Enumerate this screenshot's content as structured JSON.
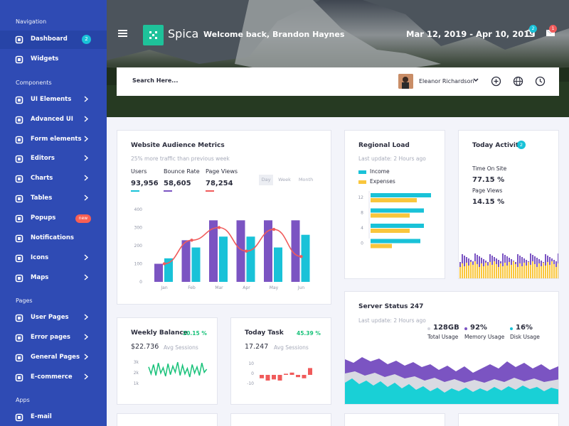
{
  "sidebar": {
    "sections": [
      "Navigation",
      "Components",
      "Pages",
      "Apps"
    ],
    "items": [
      {
        "label": "Dashboard",
        "icon": "dashboard-icon",
        "badge": "2"
      },
      {
        "label": "Widgets",
        "icon": "monitor-icon"
      },
      {
        "label": "UI Elements",
        "icon": "palette-icon"
      },
      {
        "label": "Advanced UI",
        "icon": "layers-icon"
      },
      {
        "label": "Form elements",
        "icon": "form-icon"
      },
      {
        "label": "Editors",
        "icon": "edit-icon"
      },
      {
        "label": "Charts",
        "icon": "pie-chart-icon"
      },
      {
        "label": "Tables",
        "icon": "table-icon"
      },
      {
        "label": "Popups",
        "icon": "chat-icon",
        "badge": "new"
      },
      {
        "label": "Notifications",
        "icon": "bell-icon"
      },
      {
        "label": "Icons",
        "icon": "smile-icon"
      },
      {
        "label": "Maps",
        "icon": "map-icon"
      },
      {
        "label": "User Pages",
        "icon": "user-icon"
      },
      {
        "label": "Error pages",
        "icon": "warning-icon"
      },
      {
        "label": "General Pages",
        "icon": "file-icon"
      },
      {
        "label": "E-commerce",
        "icon": "cart-icon"
      },
      {
        "label": "E-mail",
        "icon": "mail-icon"
      }
    ]
  },
  "header": {
    "logo": "Spica",
    "welcome": "Welcome back, Brandon Haynes",
    "date_range": "Mar 12, 2019 - Apr 10, 2019",
    "notif_badge": "2",
    "mail_badge": "1",
    "search_placeholder": "Search Here...",
    "user_name": "Eleanor Richardson"
  },
  "audience": {
    "title": "Website Audience Metrics",
    "subtitle": "25% more traffic than previous week",
    "stats": [
      {
        "label": "Users",
        "value": "93,956"
      },
      {
        "label": "Bounce Rate",
        "value": "58,605"
      },
      {
        "label": "Page Views",
        "value": "78,254"
      }
    ],
    "tabs": [
      "Day",
      "Week",
      "Month"
    ]
  },
  "regional": {
    "title": "Regional Load",
    "update": "Last update: 2 Hours ago",
    "legend": [
      "Income",
      "Expenses"
    ]
  },
  "activity": {
    "title": "Today Activity",
    "badge": "2",
    "label1": "Time On Site",
    "value1": "77.15 %",
    "label2": "Page Views",
    "value2": "14.15 %"
  },
  "server": {
    "title": "Server Status 247",
    "update": "Last update: 2 Hours ago",
    "stats": [
      {
        "value": "128GB",
        "label": "Total Usage"
      },
      {
        "value": "92%",
        "label": "Memory Usage"
      },
      {
        "value": "16%",
        "label": "Disk Usage"
      }
    ]
  },
  "weekly": {
    "title": "Weekly Balance",
    "percent": "20.15 %",
    "value": "$22.736",
    "caption": "Avg Sessions"
  },
  "task": {
    "title": "Today Task",
    "percent": "45.39 %",
    "value": "17.247",
    "caption": "Avg Sessions"
  },
  "colors": {
    "sidebar": "#2f4bb4",
    "teal": "#19c2d8",
    "purple": "#7b54c2",
    "red": "#f05b5b",
    "yellow": "#f9c63c",
    "green": "#19c27a"
  },
  "chart_data": [
    {
      "type": "bar",
      "categories": [
        "Jan",
        "Feb",
        "Mar",
        "Apr",
        "May",
        "Jun"
      ],
      "yticks": [
        "0",
        "100",
        "200",
        "300",
        "400"
      ],
      "ylim": [
        0,
        400
      ],
      "series": [
        {
          "values": [
            100,
            230,
            340,
            340,
            340,
            340
          ]
        },
        {
          "values": [
            130,
            190,
            250,
            250,
            190,
            260
          ]
        },
        {
          "values": [
            100,
            230,
            300,
            170,
            290,
            140
          ]
        }
      ]
    },
    {
      "type": "bar",
      "categories": [
        "12",
        "8",
        "4",
        "0"
      ],
      "series": [
        {
          "name": "Income",
          "values": [
            85,
            75,
            75,
            70
          ]
        },
        {
          "name": "Expenses",
          "values": [
            65,
            55,
            55,
            30
          ]
        }
      ]
    },
    {
      "type": "line",
      "yticks": [
        "3k",
        "2k",
        "1k"
      ],
      "values": [
        2.3,
        1.4,
        2.6,
        1.2,
        2.8,
        1.5,
        2.2,
        1.1,
        2.7,
        1.3,
        2.4,
        1.6,
        2.9,
        1.2,
        2.5,
        1.4,
        2.1,
        1.0,
        2.6,
        1.5,
        2.3,
        1.2,
        2.8,
        1.6,
        2.0
      ]
    },
    {
      "type": "bar",
      "yticks": [
        "10",
        "0",
        "-10"
      ],
      "ylim": [
        -12,
        12
      ],
      "values": [
        -3,
        -5,
        -4,
        -5,
        1,
        2,
        -2,
        -3,
        6
      ]
    }
  ]
}
